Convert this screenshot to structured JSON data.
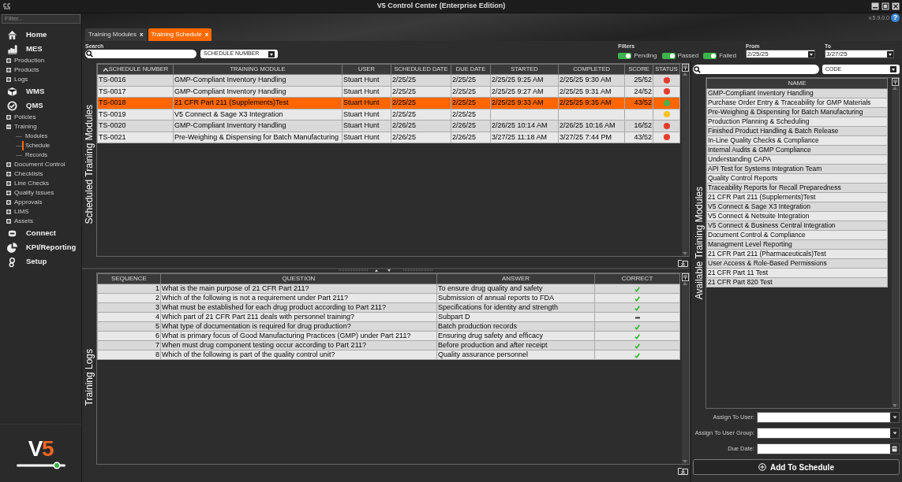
{
  "window": {
    "title": "V5 Control Center (Enterprise Edition)",
    "version": "v.5.9.0.0",
    "help": "?"
  },
  "sidebar": {
    "filter_placeholder": "Filter..",
    "items": [
      {
        "kind": "section",
        "label": "Home"
      },
      {
        "kind": "section",
        "label": "MES"
      },
      {
        "kind": "node",
        "label": "Production",
        "expanded": false
      },
      {
        "kind": "node",
        "label": "Products",
        "expanded": false
      },
      {
        "kind": "node",
        "label": "Logs",
        "expanded": false
      },
      {
        "kind": "section",
        "label": "WMS"
      },
      {
        "kind": "section",
        "label": "QMS"
      },
      {
        "kind": "node",
        "label": "Policies",
        "expanded": false
      },
      {
        "kind": "node",
        "label": "Training",
        "expanded": true,
        "children": [
          {
            "label": "Modules",
            "selected": false
          },
          {
            "label": "Schedule",
            "selected": true
          },
          {
            "label": "Records",
            "selected": false
          }
        ]
      },
      {
        "kind": "node",
        "label": "Document Control",
        "expanded": false
      },
      {
        "kind": "node",
        "label": "Checklists",
        "expanded": false
      },
      {
        "kind": "node",
        "label": "Line Checks",
        "expanded": false
      },
      {
        "kind": "node",
        "label": "Quality Issues",
        "expanded": false
      },
      {
        "kind": "node",
        "label": "Approvals",
        "expanded": false
      },
      {
        "kind": "node",
        "label": "LIMS",
        "expanded": false
      },
      {
        "kind": "node",
        "label": "Assets",
        "expanded": false
      },
      {
        "kind": "section",
        "label": "Connect"
      },
      {
        "kind": "section",
        "label": "KPI/Reporting"
      },
      {
        "kind": "section",
        "label": "Setup"
      }
    ],
    "logo": "V5"
  },
  "tabs": [
    {
      "label": "Training Modules",
      "close": "x",
      "selected": false
    },
    {
      "label": "Training Schedule",
      "close": "x",
      "selected": true
    }
  ],
  "search": {
    "label": "Search",
    "search_by": "SCHEDULE NUMBER"
  },
  "filters": {
    "label": "Filters",
    "toggles": [
      {
        "label": "Pending",
        "on": true
      },
      {
        "label": "Passed",
        "on": true
      },
      {
        "label": "Failed",
        "on": true
      }
    ]
  },
  "date_range": {
    "from_label": "From",
    "from": "2/25/25",
    "to_label": "To",
    "to": "3/27/25"
  },
  "scheduled_training_modules": {
    "title": "Scheduled Training Modules",
    "columns": [
      {
        "label": "SCHEDULE NUMBER",
        "sorted": true
      },
      {
        "label": "TRAINING MODULE",
        "sorted": false
      },
      {
        "label": "USER",
        "sorted": false
      },
      {
        "label": "SCHEDULED DATE",
        "sorted": false
      },
      {
        "label": "DUE DATE",
        "sorted": false
      },
      {
        "label": "STARTED",
        "sorted": false
      },
      {
        "label": "COMPLETED",
        "sorted": false
      },
      {
        "label": "SCORE",
        "sorted": false
      },
      {
        "label": "STATUS",
        "sorted": false
      }
    ],
    "rows": [
      {
        "cells": [
          "TS-0016",
          "GMP-Compliant Inventory Handling",
          "Stuart Hunt",
          "2/25/25",
          "2/25/25",
          "2/25/25 9:25 AM",
          "2/25/25 9:30 AM",
          "25/52"
        ],
        "color": "#e53b2c",
        "selected": false
      },
      {
        "cells": [
          "TS-0017",
          "GMP-Compliant Inventory Handling",
          "Stuart Hunt",
          "2/25/25",
          "2/25/25",
          "2/25/25 9:27 AM",
          "2/25/25 9:31 AM",
          "24/52"
        ],
        "color": "#e53b2c",
        "selected": false
      },
      {
        "cells": [
          "TS-0018",
          "21 CFR Part 211 (Supplements)Test",
          "Stuart Hunt",
          "2/25/25",
          "2/25/25",
          "2/25/25 9:33 AM",
          "2/25/25 9:35 AM",
          "43/52"
        ],
        "color": "#4caf50",
        "selected": true
      },
      {
        "cells": [
          "TS-0019",
          "V5 Connect & Sage X3 Integration",
          "Stuart Hunt",
          "2/25/25",
          "2/25/25",
          "",
          "",
          ""
        ],
        "color": "#f6c21c",
        "selected": false
      },
      {
        "cells": [
          "TS-0020",
          "GMP-Compliant Inventory Handling",
          "Stuart Hunt",
          "2/26/25",
          "2/26/25",
          "2/26/25 10:14 AM",
          "2/26/25 10:16 AM",
          "16/52"
        ],
        "color": "#e53b2c",
        "selected": false
      },
      {
        "cells": [
          "TS-0021",
          "Pre-Weighing & Dispensing for Batch Manufacturing",
          "Stuart Hunt",
          "2/26/25",
          "2/26/25",
          "3/27/25 11:18 AM",
          "3/27/25 7:44 PM",
          "43/52"
        ],
        "color": "#e53b2c",
        "selected": false
      }
    ]
  },
  "training_logs": {
    "title": "Training Logs",
    "columns": [
      "SEQUENCE",
      "QUESTION",
      "ANSWER",
      "CORRECT"
    ],
    "rows": [
      {
        "sequence": "1",
        "question": "What is the main purpose of 21 CFR Part 211?",
        "answer": "To ensure drug quality and safety",
        "correct": true
      },
      {
        "sequence": "2",
        "question": "Which of the following is not a requirement under Part 211?",
        "answer": "Submission of annual reports to FDA",
        "correct": true
      },
      {
        "sequence": "3",
        "question": "What must be established for each drug product according to Part 211?",
        "answer": "Specifications for identity and strength",
        "correct": true
      },
      {
        "sequence": "4",
        "question": "Which part of 21 CFR Part 211 deals with personnel training?",
        "answer": "Subpart D",
        "correct": false
      },
      {
        "sequence": "5",
        "question": "What type of documentation is required for drug production?",
        "answer": "Batch production records",
        "correct": true
      },
      {
        "sequence": "6",
        "question": "What is primary focus of Good Manufacturing Practices (GMP) under Part 211?",
        "answer": "Ensuring drug safety and efficacy",
        "correct": true
      },
      {
        "sequence": "7",
        "question": "When must drug component testing occur according to Part 211?",
        "answer": "Before production and after receipt",
        "correct": true
      },
      {
        "sequence": "8",
        "question": "Which of the following is part of the quality control unit?",
        "answer": "Quality assurance personnel",
        "correct": true
      }
    ]
  },
  "available_training_modules": {
    "title": "Available Training Modules",
    "search_by": "CODE",
    "column": "NAME",
    "items": [
      "GMP-Compliant Inventory Handling",
      "Purchase Order Entry & Traceability for GMP Materials",
      "Pre-Weighing & Dispensing for Batch Manufacturing",
      "Production Planning & Scheduling",
      "Finished Product Handling & Batch Release",
      "In-Line Quality Checks & Compliance",
      "Internal Audits & GMP Compliance",
      "Understanding CAPA",
      "API Test for Systems Integration Team",
      "Quality Control Reports",
      "Traceability Reports for Recall Preparedness",
      "21 CFR Part 211 (Supplements)Test",
      "V5 Connect & Sage X3 Integration",
      "V5 Connect & Netsuite Integration",
      "V5 Connect & Business Central Integration",
      "Document Control & Compliance",
      "Managment Level Reporting",
      "21 CFR Part 211 (Pharmaceuticals)Test",
      "User Access & Role-Based Permissions",
      "21 CFR Part 11 Test",
      "21 CFR Part 820 Test"
    ]
  },
  "assign_form": {
    "fields": [
      {
        "label": "Assign To User:",
        "kind": "dropdown"
      },
      {
        "label": "Assign To User Group:",
        "kind": "dropdown"
      },
      {
        "label": "Due Date:",
        "kind": "date"
      }
    ],
    "button": "Add To Schedule"
  }
}
